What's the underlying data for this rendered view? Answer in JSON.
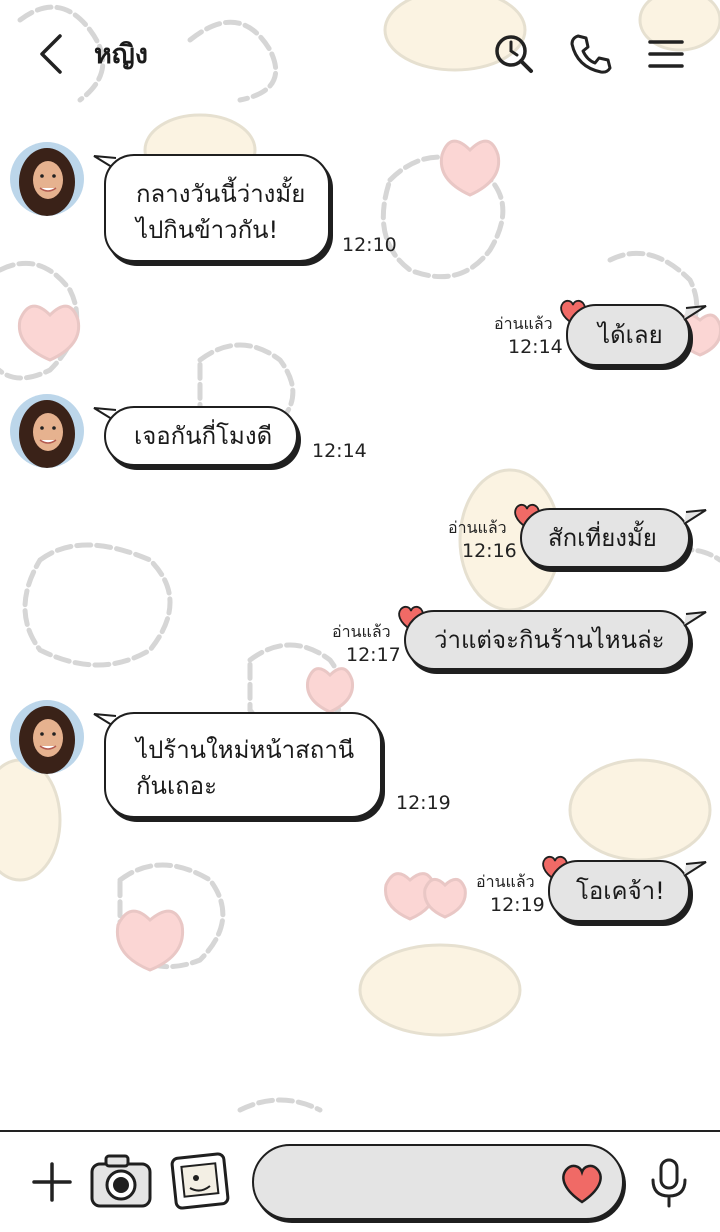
{
  "header": {
    "title": "หญิง",
    "back_icon": "chevron-left-icon",
    "icons": [
      "clock-search-icon",
      "phone-icon",
      "menu-icon"
    ]
  },
  "colors": {
    "accent_heart": "#f06a66",
    "sent_bubble": "#e4e4e4",
    "received_bubble": "#ffffff",
    "outline": "#1f1f1f"
  },
  "messages": [
    {
      "side": "received",
      "text": "กลางวันนี้ว่างมั้ย\nไปกินข้าวกัน!",
      "time": "12:10"
    },
    {
      "side": "sent",
      "text": "ได้เลย",
      "time": "12:14",
      "status": "อ่านแล้ว"
    },
    {
      "side": "received",
      "text": "เจอกันกี่โมงดี",
      "time": "12:14"
    },
    {
      "side": "sent",
      "text": "สักเที่ยงมั้ย",
      "time": "12:16",
      "status": "อ่านแล้ว"
    },
    {
      "side": "sent",
      "text": "ว่าแต่จะกินร้านไหนล่ะ",
      "time": "12:17",
      "status": "อ่านแล้ว"
    },
    {
      "side": "received",
      "text": "ไปร้านใหม่หน้าสถานี\nกันเถอะ",
      "time": "12:19"
    },
    {
      "side": "sent",
      "text": "โอเคจ้า!",
      "time": "12:19",
      "status": "อ่านแล้ว"
    }
  ],
  "footer": {
    "input_placeholder": "",
    "icons": [
      "plus-icon",
      "camera-icon",
      "photo-icon",
      "heart-icon",
      "microphone-icon"
    ]
  }
}
